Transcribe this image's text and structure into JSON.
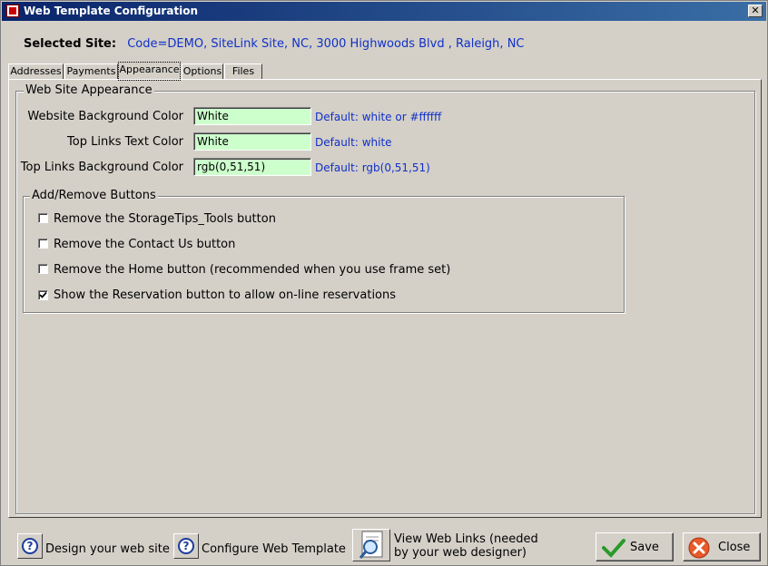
{
  "window": {
    "title": "Web Template Configuration",
    "close_glyph": "✕"
  },
  "selected_site": {
    "label": "Selected Site:",
    "value": "Code=DEMO,  SiteLink Site, NC, 3000 Highwoods Blvd , Raleigh, NC"
  },
  "tabs": [
    {
      "label": "Addresses",
      "active": false
    },
    {
      "label": "Payments",
      "active": false
    },
    {
      "label": "Appearance",
      "active": true
    },
    {
      "label": "Options",
      "active": false
    },
    {
      "label": "Files",
      "active": false
    }
  ],
  "appearance": {
    "group_title": "Web Site Appearance",
    "fields": [
      {
        "label": "Website Background Color",
        "value": "White",
        "hint": "Default: white or #ffffff"
      },
      {
        "label": "Top Links Text Color",
        "value": "White",
        "hint": "Default: white"
      },
      {
        "label": "Top Links Background Color",
        "value": "rgb(0,51,51)",
        "hint": "Default: rgb(0,51,51)"
      }
    ]
  },
  "buttons_group": {
    "title": "Add/Remove Buttons",
    "checkboxes": [
      {
        "label": "Remove the StorageTips_Tools button",
        "checked": false
      },
      {
        "label": "Remove the Contact Us button",
        "checked": false
      },
      {
        "label": "Remove the Home button (recommended when you use frame set)",
        "checked": false
      },
      {
        "label": "Show the Reservation button to allow on-line reservations",
        "checked": true
      }
    ]
  },
  "footer": {
    "design_label": "Design your web site",
    "configure_label": "Configure Web Template",
    "view_links_line1": "View Web Links (needed",
    "view_links_line2": "by your web designer)",
    "save_label": "Save",
    "close_label": "Close"
  },
  "colors": {
    "input_bg": "#ccffcc",
    "link_blue": "#1030c8",
    "title_blue": "#0a246a"
  },
  "icons": [
    "app-icon",
    "close-icon",
    "help-icon",
    "magnifier-icon",
    "checkmark-icon",
    "cancel-icon"
  ]
}
